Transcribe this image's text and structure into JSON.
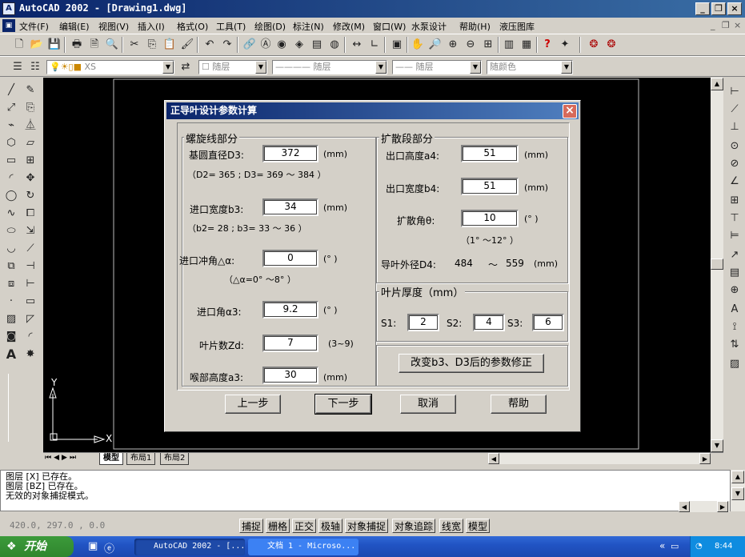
{
  "window": {
    "title": "AutoCAD 2002 - [Drawing1.dwg]",
    "app_icon": "A"
  },
  "menu": [
    "文件(F)",
    "编辑(E)",
    "视图(V)",
    "插入(I)",
    "格式(O)",
    "工具(T)",
    "绘图(D)",
    "标注(N)",
    "修改(M)",
    "窗口(W)",
    "水泵设计",
    "帮助(H)",
    "液压图库"
  ],
  "layers_toolbar": {
    "layer_combo": "XS",
    "color_combo": "随层",
    "linetype_combo": "随层",
    "lineweight_combo": "随层",
    "plotstyle_combo": "随颜色"
  },
  "drawing": {
    "ucs_x": "X",
    "ucs_y": "Y"
  },
  "layout_tabs": [
    "模型",
    "布局1",
    "布局2"
  ],
  "command_history": [
    "图层 [X] 已存在。",
    "图层 [BZ] 已存在。",
    "无效的对象捕捉模式。"
  ],
  "status": {
    "coords": "420.0, 297.0 , 0.0",
    "toggles": [
      "捕捉",
      "栅格",
      "正交",
      "极轴",
      "对象捕捉",
      "对象追踪",
      "线宽",
      "模型"
    ]
  },
  "taskbar": {
    "start": "开始",
    "tasks": [
      "AutoCAD 2002 - [...",
      "文档 1 - Microso..."
    ],
    "clock": "8:44"
  },
  "dialog": {
    "title": "正导叶设计参数计算",
    "spiral": {
      "group": "螺旋线部分",
      "d3_label": "基圆直径D3:",
      "d3_value": "372",
      "d3_unit": "(mm)",
      "d3_hint": "（D2= 365  ; D3= 369 ～  384 ）",
      "b3_label": "进口宽度b3:",
      "b3_value": "34",
      "b3_unit": "(mm)",
      "b3_hint": "（b2= 28   ; b3= 33  ～  36  ）",
      "attack_label": "进口冲角△α:",
      "attack_value": "0",
      "attack_unit": "(°  )",
      "attack_hint": "（△α=0° ～8° ）",
      "alpha3_label": "进口角α3:",
      "alpha3_value": "9.2",
      "alpha3_unit": "(°  )",
      "zd_label": "叶片数Zd:",
      "zd_value": "7",
      "zd_unit": "(3~9)",
      "a3_label": "喉部高度a3:",
      "a3_value": "30",
      "a3_unit": "(mm)"
    },
    "diffuser": {
      "group": "扩散段部分",
      "a4_label": "出口高度a4:",
      "a4_value": "51",
      "a4_unit": "(mm)",
      "b4_label": "出口宽度b4:",
      "b4_value": "51",
      "b4_unit": "(mm)",
      "theta_label": "扩散角θ:",
      "theta_value": "10",
      "theta_unit": "(°  )",
      "theta_hint": "（1° ～12° ）",
      "d4_label": "导叶外径D4:",
      "d4_value": "484",
      "d4_tilde": "～",
      "d4_max": "559",
      "d4_unit": "(mm)"
    },
    "thickness": {
      "group": "叶片厚度（mm）",
      "s1_label": "S1:",
      "s1_value": "2",
      "s2_label": "S2:",
      "s2_value": "4",
      "s3_label": "S3:",
      "s3_value": "6"
    },
    "correction_button": "改变b3、D3后的参数修正",
    "buttons": {
      "prev": "上一步",
      "next": "下一步",
      "cancel": "取消",
      "help": "帮助"
    }
  }
}
